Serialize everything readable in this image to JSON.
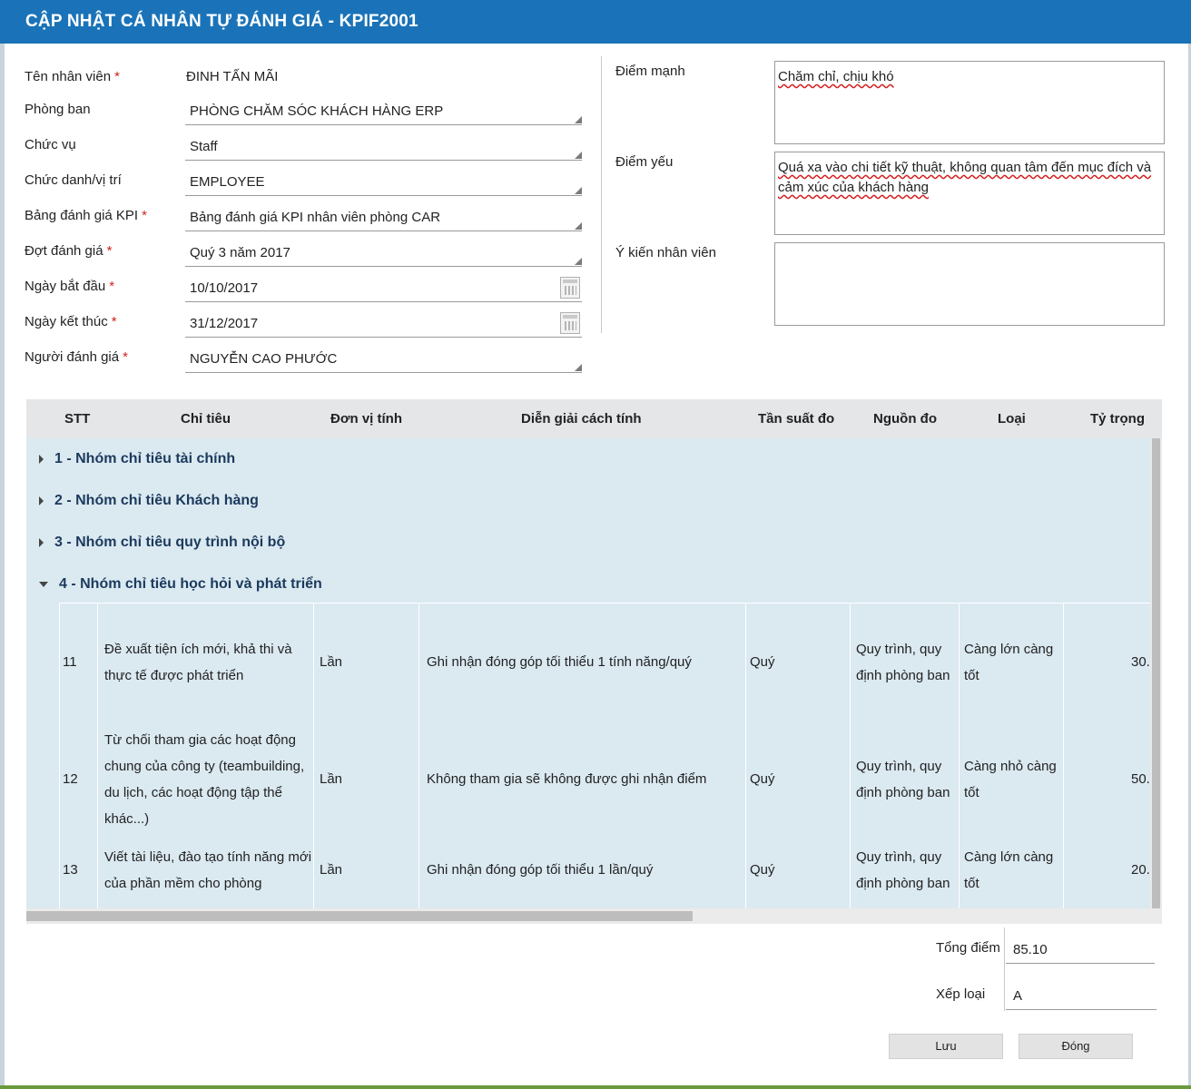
{
  "title": "CẬP NHẬT CÁ NHÂN TỰ ĐÁNH GIÁ - KPIF2001",
  "form": {
    "employee_name": {
      "label": "Tên nhân viên",
      "value": "ĐINH TẤN MÃI"
    },
    "department": {
      "label": "Phòng ban",
      "value": "PHÒNG CHĂM SÓC KHÁCH HÀNG ERP"
    },
    "job": {
      "label": "Chức vụ",
      "value": "Staff"
    },
    "position": {
      "label": "Chức danh/vị trí",
      "value": "EMPLOYEE"
    },
    "kpi_table": {
      "label": "Bảng đánh giá KPI",
      "value": "Bảng đánh giá KPI nhân viên phòng CAR"
    },
    "period": {
      "label": "Đợt đánh giá",
      "value": "Quý 3 năm 2017"
    },
    "start_date": {
      "label": "Ngày bắt đầu",
      "value": "10/10/2017"
    },
    "end_date": {
      "label": "Ngày kết thúc",
      "value": "31/12/2017"
    },
    "evaluator": {
      "label": "Người đánh giá",
      "value": "NGUYỄN CAO PHƯỚC"
    },
    "strengths": {
      "label": "Điểm mạnh",
      "value": "Chăm chỉ, chịu khó"
    },
    "weaknesses": {
      "label": "Điểm yếu",
      "value": "Quá xa vào chi tiết kỹ thuật, không quan tâm đến mục đích và cảm xúc của khách hàng"
    },
    "employee_opinion": {
      "label": "Ý kiến nhân viên",
      "value": ""
    }
  },
  "grid": {
    "columns": [
      "STT",
      "Chỉ tiêu",
      "Đơn vị tính",
      "Diễn giải cách tính",
      "Tần suất đo",
      "Nguồn đo",
      "Loại",
      "Tỷ trọng"
    ],
    "groups": [
      {
        "label": "1 - Nhóm chỉ tiêu tài chính",
        "expanded": false
      },
      {
        "label": "2 - Nhóm chỉ tiêu Khách hàng",
        "expanded": false
      },
      {
        "label": "3 - Nhóm chỉ tiêu quy trình nội bộ",
        "expanded": false
      },
      {
        "label": "4 - Nhóm chỉ tiêu học hỏi và phát triển",
        "expanded": true
      }
    ],
    "rows": [
      {
        "stt": "11",
        "chi_tieu_lines": [
          "Đề xuất tiện ích mới, khả thi và",
          "thực tế được phát triển"
        ],
        "don_vi": "Lần",
        "dien_giai": "Ghi nhận đóng góp tối thiểu 1 tính năng/quý",
        "tan_suat": "Quý",
        "nguon_lines": [
          "Quy trình, quy",
          "định phòng ban"
        ],
        "loai_lines": [
          "Càng lớn càng",
          "tốt"
        ],
        "ty_trong": "30."
      },
      {
        "stt": "12",
        "chi_tieu_lines": [
          "Từ chối tham gia các hoạt động",
          "chung của công ty (teambuilding,",
          "du lịch, các hoạt động tập thể",
          "khác...)"
        ],
        "don_vi": "Lần",
        "dien_giai": "Không tham gia sẽ không được ghi nhận điểm",
        "tan_suat": "Quý",
        "nguon_lines": [
          "Quy trình, quy",
          "định phòng ban"
        ],
        "loai_lines": [
          "Càng nhỏ càng",
          "tốt"
        ],
        "ty_trong": "50."
      },
      {
        "stt": "13",
        "chi_tieu_lines": [
          "Viết tài liệu, đào tạo tính năng mới",
          "của phần mềm cho phòng"
        ],
        "don_vi": "Lần",
        "dien_giai": "Ghi nhận đóng góp tối thiểu 1 lần/quý",
        "tan_suat": "Quý",
        "nguon_lines": [
          "Quy trình, quy",
          "định phòng ban"
        ],
        "loai_lines": [
          "Càng lớn càng",
          "tốt"
        ],
        "ty_trong": "20."
      }
    ]
  },
  "summary": {
    "total_label": "Tổng điểm",
    "total_value": "85.10",
    "rank_label": "Xếp loại",
    "rank_value": "A"
  },
  "buttons": {
    "save": "Lưu",
    "close": "Đóng"
  },
  "colors": {
    "title_bar": "#1a73b8",
    "required": "#d21f1f",
    "group_text": "#1b3a5c",
    "grid_body": "#dbe9f1"
  },
  "icons": {
    "date_picker": "calendar-icon",
    "expand": "caret-right-icon",
    "collapse": "caret-down-icon"
  }
}
